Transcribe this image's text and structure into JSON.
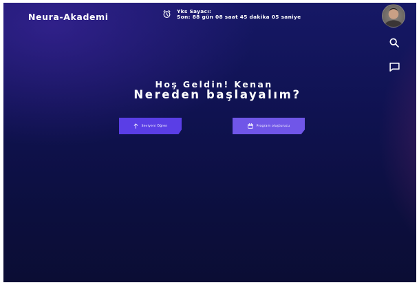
{
  "header": {
    "logo": "Neura-Akademi",
    "counter": {
      "title": "Yks Sayacı:",
      "remaining": "Son: 88 gün 08 saat 45 dakika 05 saniye"
    }
  },
  "nav": {
    "icons": [
      "search-icon",
      "chat-icon"
    ]
  },
  "hero": {
    "greeting": "Hoş Geldin! Kenan",
    "question": "Nereden başlayalım?"
  },
  "actions": {
    "level_label": "Seviyeni Öğren",
    "program_label": "Program oluşturucu"
  },
  "colors": {
    "background": "#0f1250",
    "level_button": "#5a3ee6",
    "program_button": "#7056e8",
    "text": "#ffffff"
  }
}
